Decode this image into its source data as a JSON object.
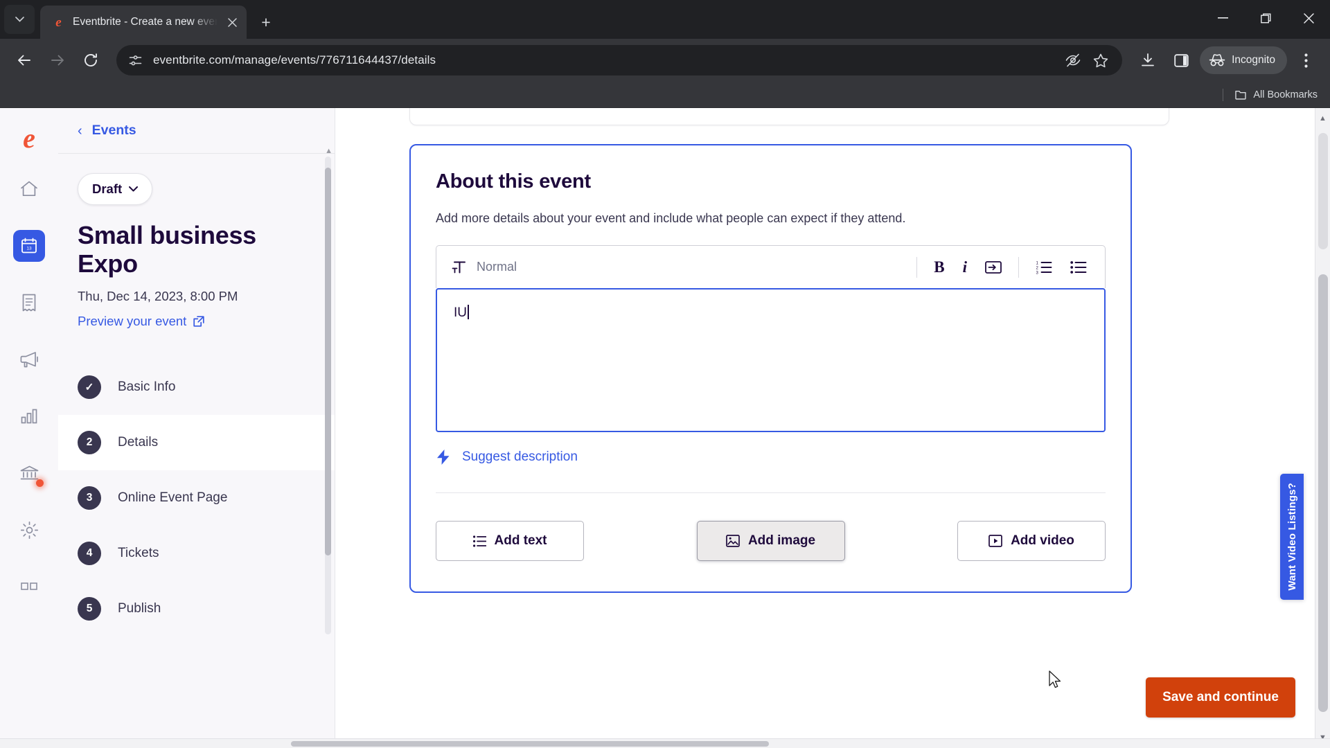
{
  "browser": {
    "tab": {
      "title": "Eventbrite - Create a new event",
      "favicon": "eventbrite-e-icon",
      "close": "×"
    },
    "new_tab_label": "+",
    "tab_search_icon": "chevron-down-icon",
    "window_controls": {
      "minimize": "−",
      "maximize": "❐",
      "close": "✕"
    },
    "nav": {
      "back": "←",
      "forward": "→",
      "reload": "⟳"
    },
    "omnibox": {
      "url": "eventbrite.com/manage/events/776711644437/details",
      "site_info_icon": "site-settings-icon",
      "icons": [
        "tracking-protection-icon",
        "bookmark-star-icon"
      ]
    },
    "toolbar_right": {
      "download_icon": "download-icon",
      "sidepanel_icon": "side-panel-icon",
      "incognito_label": "Incognito",
      "menu_icon": "three-dot-menu-icon"
    },
    "bookmarks_bar": {
      "label": "All Bookmarks",
      "icon": "folder-icon"
    }
  },
  "rail": {
    "logo": "e",
    "items": [
      {
        "name": "home",
        "icon": "home-icon",
        "active": false,
        "badge": false
      },
      {
        "name": "events",
        "icon": "calendar-icon",
        "active": true,
        "badge": false
      },
      {
        "name": "orders",
        "icon": "receipt-icon",
        "active": false,
        "badge": false
      },
      {
        "name": "marketing",
        "icon": "megaphone-icon",
        "active": false,
        "badge": false
      },
      {
        "name": "reports",
        "icon": "bar-chart-icon",
        "active": false,
        "badge": false
      },
      {
        "name": "finance",
        "icon": "bank-icon",
        "active": false,
        "badge": true
      },
      {
        "name": "settings",
        "icon": "gear-icon",
        "active": false,
        "badge": false
      },
      {
        "name": "apps",
        "icon": "apps-grid-icon",
        "active": false,
        "badge": false
      }
    ]
  },
  "sidebar": {
    "back_label": "Events",
    "back_icon": "chevron-left-icon",
    "status": {
      "label": "Draft",
      "chevron": "chevron-down-icon"
    },
    "event_title": "Small business Expo",
    "event_date": "Thu, Dec 14, 2023, 8:00 PM",
    "preview_link": "Preview your event",
    "preview_icon": "external-link-icon",
    "steps": [
      {
        "badge": "✓",
        "label": "Basic Info",
        "state": "complete"
      },
      {
        "badge": "2",
        "label": "Details",
        "state": "active"
      },
      {
        "badge": "3",
        "label": "Online Event Page",
        "state": "pending"
      },
      {
        "badge": "4",
        "label": "Tickets",
        "state": "pending"
      },
      {
        "badge": "5",
        "label": "Publish",
        "state": "pending"
      }
    ]
  },
  "main": {
    "card": {
      "title": "About this event",
      "subtitle": "Add more details about your event and include what people can expect if they attend."
    },
    "editor": {
      "format_icon": "text-format-icon",
      "format_value": "Normal",
      "bold": "B",
      "italic": "i",
      "link_icon": "link-icon",
      "ordered_list_icon": "ordered-list-icon",
      "bullet_list_icon": "bullet-list-icon",
      "content": "IU"
    },
    "suggest": {
      "label": "Suggest description",
      "icon": "lightning-bolt-icon"
    },
    "add_buttons": [
      {
        "label": "Add text",
        "icon": "text-lines-icon",
        "hovered": false
      },
      {
        "label": "Add image",
        "icon": "image-icon",
        "hovered": true
      },
      {
        "label": "Add video",
        "icon": "video-icon",
        "hovered": false
      }
    ],
    "video_tab_label": "Want Video Listings?",
    "save_button": "Save and continue"
  },
  "colors": {
    "brand_orange": "#f05537",
    "save_orange": "#d1410c",
    "accent_blue": "#3659e3",
    "text_dark": "#1e0a3c"
  }
}
